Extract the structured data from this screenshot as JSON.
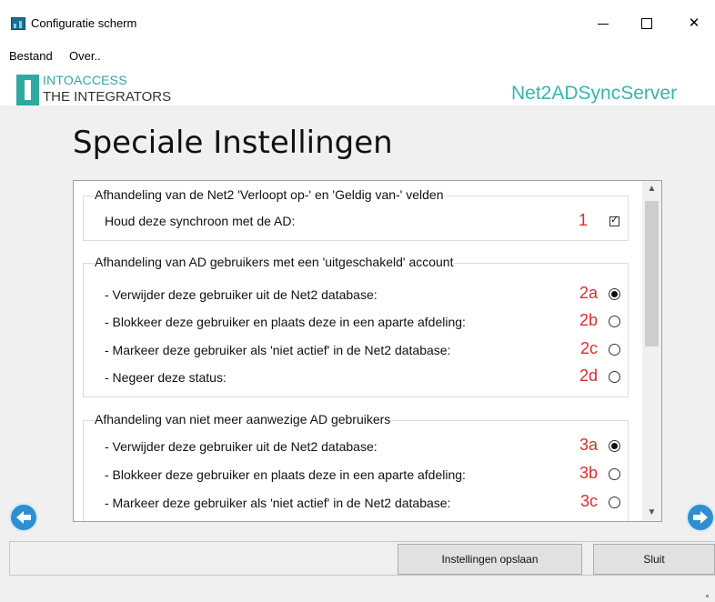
{
  "window": {
    "title": "Configuratie scherm",
    "minimize_glyph": "—",
    "close_glyph": "✕"
  },
  "menu": {
    "items": [
      "Bestand",
      "Over.."
    ]
  },
  "header": {
    "logo_line1": "INTOACCESS",
    "logo_line2": "THE INTEGRATORS",
    "product": "Net2ADSyncServer"
  },
  "page_title": "Speciale Instellingen",
  "groups": [
    {
      "legend": "Afhandeling van de  Net2 'Verloopt op-' en 'Geldig van-' velden",
      "rows": [
        {
          "label": "Houd deze synchroon met de AD:",
          "num": "1",
          "control": "checkbox",
          "checked": true
        }
      ]
    },
    {
      "legend": "Afhandeling van AD gebruikers met een 'uitgeschakeld' account",
      "rows": [
        {
          "label": "- Verwijder deze gebruiker uit de Net2 database:",
          "num": "2a",
          "control": "radio",
          "checked": true
        },
        {
          "label": "- Blokkeer deze gebruiker en plaats deze in een aparte afdeling:",
          "num": "2b",
          "control": "radio",
          "checked": false
        },
        {
          "label": "- Markeer deze gebruiker als 'niet actief' in de Net2 database:",
          "num": "2c",
          "control": "radio",
          "checked": false
        },
        {
          "label": "- Negeer deze status:",
          "num": "2d",
          "control": "radio",
          "checked": false
        }
      ]
    },
    {
      "legend": "Afhandeling van niet meer aanwezige AD gebruikers",
      "rows": [
        {
          "label": "- Verwijder deze gebruiker uit de Net2 database:",
          "num": "3a",
          "control": "radio",
          "checked": true
        },
        {
          "label": "- Blokkeer deze gebruiker en plaats deze in een aparte afdeling:",
          "num": "3b",
          "control": "radio",
          "checked": false
        },
        {
          "label": "- Markeer deze gebruiker als 'niet actief' in de Net2 database:",
          "num": "3c",
          "control": "radio",
          "checked": false
        }
      ]
    }
  ],
  "footer": {
    "save_label": "Instellingen opslaan",
    "close_label": "Sluit"
  },
  "colors": {
    "accent": "#2fa9a0",
    "number_red": "#e02b2b",
    "nav_blue": "#2f8fd0"
  }
}
